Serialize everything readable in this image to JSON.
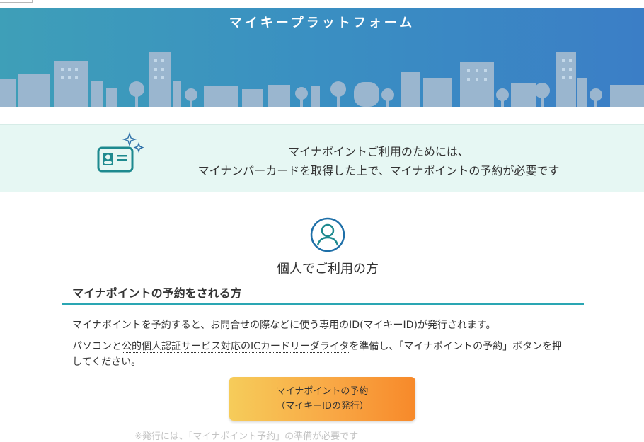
{
  "banner": {
    "title": "マイキープラットフォーム"
  },
  "notice": {
    "line1": "マイナポイントご利用のためには、",
    "line2": "マイナンバーカードを取得した上で、マイナポイントの予約が必要です",
    "icon": "id-card-icon"
  },
  "personal": {
    "title": "個人でご利用の方",
    "icon": "person-icon"
  },
  "section": {
    "heading": "マイナポイントの予約をされる方",
    "para1": "マイナポイントを予約すると、お問合せの際などに使う専用のID(マイキーID)が発行されます。",
    "para2_prefix": "パソコンと",
    "para2_link": "公的個人認証サービス対応のICカードリーダライタ",
    "para2_suffix": "を準備し、「マイナポイントの予約」ボタンを押してください。"
  },
  "cta": {
    "line1": "マイナポイントの予約",
    "line2": "（マイキーIDの発行）"
  },
  "footer": {
    "partial_text": "※発行には、「マイナポイント予約」の準備が必要です"
  },
  "colors": {
    "banner_start": "#3e9fb8",
    "banner_end": "#3b7ec6",
    "notice_bg": "#e6f7f3",
    "teal": "#1e8a8f",
    "cta_start": "#f6cc5a",
    "cta_end": "#f7892a"
  }
}
